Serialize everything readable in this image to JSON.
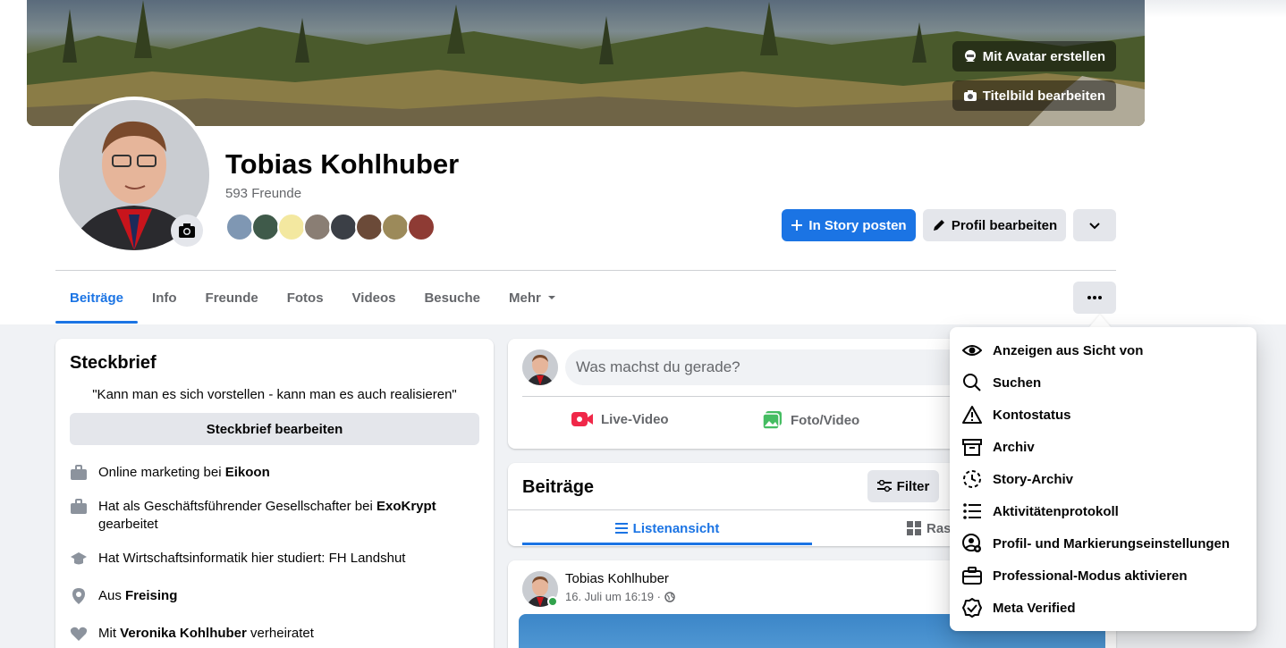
{
  "cover": {
    "avatar_button": "Mit Avatar erstellen",
    "edit_cover_button": "Titelbild bearbeiten"
  },
  "profile": {
    "name": "Tobias Kohlhuber",
    "friends_count": "593 Freunde",
    "story_button": "In Story posten",
    "edit_profile_button": "Profil bearbeiten"
  },
  "tabs": [
    "Beiträge",
    "Info",
    "Freunde",
    "Fotos",
    "Videos",
    "Besuche",
    "Mehr"
  ],
  "intro": {
    "title": "Steckbrief",
    "bio": "\"Kann man es sich vorstellen - kann man es auch realisieren\"",
    "edit_button": "Steckbrief bearbeiten",
    "rows": [
      {
        "pre": "Online marketing bei ",
        "bold": "Eikoon",
        "post": "",
        "icon": "briefcase-icon"
      },
      {
        "pre": "Hat als Geschäftsführender Gesellschafter bei ",
        "bold": "ExoKrypt",
        "post": " gearbeitet",
        "icon": "briefcase-icon"
      },
      {
        "pre": "Hat Wirtschaftsinformatik hier studiert: FH Landshut",
        "bold": "",
        "post": "",
        "icon": "graduation-cap-icon"
      },
      {
        "pre": "Aus ",
        "bold": "Freising",
        "post": "",
        "icon": "location-pin-icon"
      },
      {
        "pre": "Mit ",
        "bold": "Veronika Kohlhuber",
        "post": " verheiratet",
        "icon": "heart-icon"
      }
    ]
  },
  "composer": {
    "placeholder": "Was machst du gerade?",
    "live_video": "Live-Video",
    "photo_video": "Foto/Video"
  },
  "posts": {
    "title": "Beiträge",
    "filter": "Filter",
    "list_view": "Listenansicht",
    "grid_view": "Rast"
  },
  "post": {
    "author": "Tobias Kohlhuber",
    "time": "16. Juli um 16:19 ·"
  },
  "menu": [
    {
      "label": "Anzeigen aus Sicht von",
      "icon": "eye-icon"
    },
    {
      "label": "Suchen",
      "icon": "search-icon"
    },
    {
      "label": "Kontostatus",
      "icon": "warning-icon"
    },
    {
      "label": "Archiv",
      "icon": "archive-icon"
    },
    {
      "label": "Story-Archiv",
      "icon": "story-archive-icon"
    },
    {
      "label": "Aktivitätenprotokoll",
      "icon": "list-icon"
    },
    {
      "label": "Profil- und Markierungseinstellungen",
      "icon": "profile-settings-icon"
    },
    {
      "label": "Professional-Modus aktivieren",
      "icon": "briefcase-icon"
    },
    {
      "label": "Meta Verified",
      "icon": "verified-badge-icon"
    }
  ],
  "colors": {
    "accent": "#1b74e4",
    "page_bg": "#f0f2f5",
    "online": "#31a24c"
  }
}
